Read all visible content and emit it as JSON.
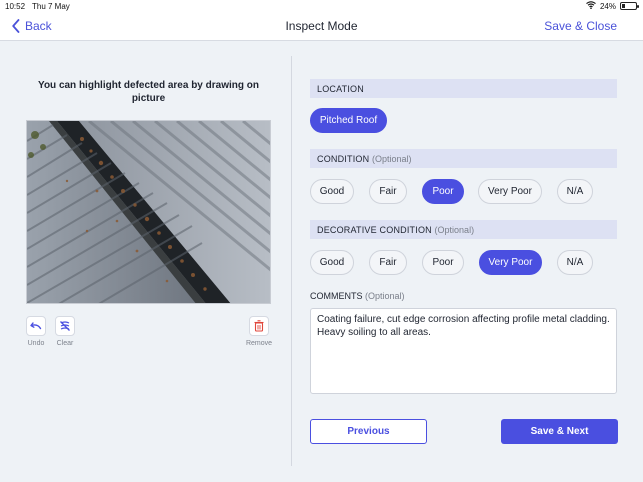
{
  "status_bar": {
    "time": "10:52",
    "date": "Thu 7 May",
    "battery": "24%",
    "battery_level": 0.24,
    "icons": [
      "wifi-icon",
      "battery-icon"
    ]
  },
  "nav": {
    "back_label": "Back",
    "title": "Inspect Mode",
    "save_close_label": "Save & Close"
  },
  "photo_panel": {
    "hint": "You can highlight defected area by drawing on picture",
    "tools": {
      "undo_label": "Undo",
      "clear_label": "Clear",
      "remove_label": "Remove"
    }
  },
  "location": {
    "header": "LOCATION",
    "options": [
      {
        "label": "Pitched Roof",
        "selected": true
      }
    ]
  },
  "condition": {
    "header": "CONDITION",
    "optional": "(Optional)",
    "options": [
      {
        "label": "Good",
        "selected": false
      },
      {
        "label": "Fair",
        "selected": false
      },
      {
        "label": "Poor",
        "selected": true
      },
      {
        "label": "Very Poor",
        "selected": false
      },
      {
        "label": "N/A",
        "selected": false
      }
    ]
  },
  "decorative_condition": {
    "header": "DECORATIVE CONDITION",
    "optional": "(Optional)",
    "options": [
      {
        "label": "Good",
        "selected": false
      },
      {
        "label": "Fair",
        "selected": false
      },
      {
        "label": "Poor",
        "selected": false
      },
      {
        "label": "Very Poor",
        "selected": true
      },
      {
        "label": "N/A",
        "selected": false
      }
    ]
  },
  "comments": {
    "label": "COMMENTS",
    "optional": "(Optional)",
    "value": "Coating failure, cut edge corrosion affecting profile metal cladding. Heavy soiling to all areas."
  },
  "buttons": {
    "previous_label": "Previous",
    "save_next_label": "Save & Next"
  },
  "colors": {
    "accent": "#4a4fe0",
    "link": "#4a52d9",
    "header_bg": "#dde1f3",
    "page_bg": "#eef2f6"
  }
}
